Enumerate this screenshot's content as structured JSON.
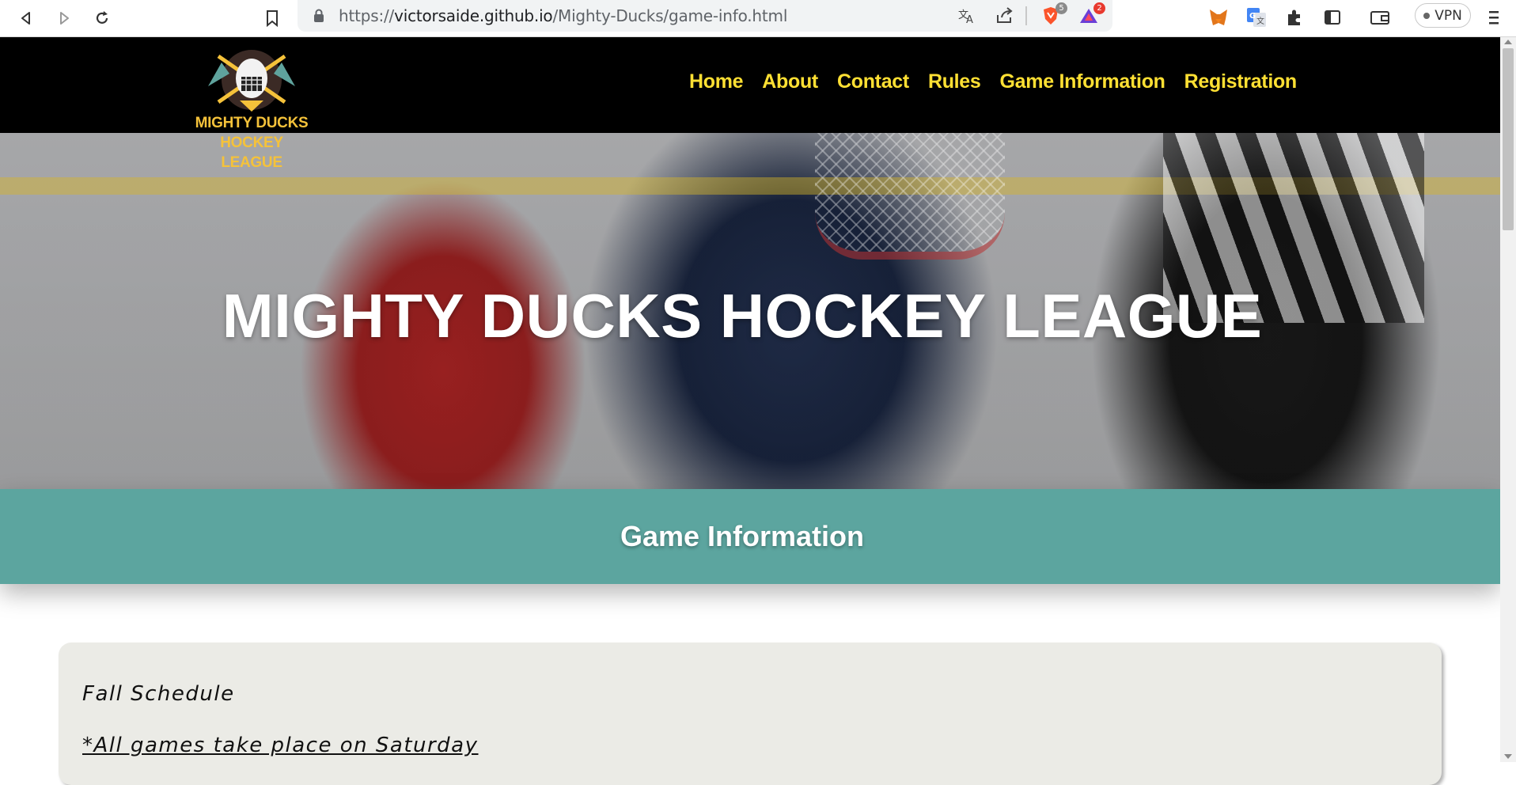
{
  "browser": {
    "url_prefix": "https://",
    "url_host": "victorsaide.github.io",
    "url_path": "/Mighty-Ducks/game-info.html",
    "brave_badge": "5",
    "rewards_badge": "2",
    "vpn_label": "VPN"
  },
  "site": {
    "logo_line1": "MIGHTY DUCKS",
    "logo_line2": "HOCKEY LEAGUE",
    "nav": [
      "Home",
      "About",
      "Contact",
      "Rules",
      "Game Information",
      "Registration"
    ]
  },
  "hero": {
    "title": "MIGHTY DUCKS HOCKEY LEAGUE"
  },
  "section": {
    "title": "Game Information"
  },
  "card": {
    "heading": "Fall Schedule",
    "note": "*All games take place on Saturday"
  },
  "colors": {
    "nav_text": "#ffe033",
    "banner": "#5ca59f",
    "card_bg": "#ebebe6",
    "logo_gold": "#f5c23a"
  }
}
